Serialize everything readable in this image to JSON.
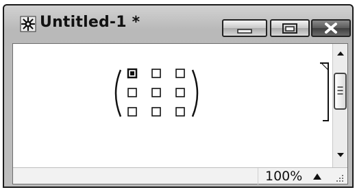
{
  "window": {
    "title": "Untitled-1 *",
    "icon": "app-gear-icon",
    "controls": [
      "minimize-icon",
      "maximize-icon",
      "close-icon"
    ]
  },
  "document": {
    "matrix": {
      "rows": 3,
      "cols": 3,
      "selected": [
        0,
        0
      ]
    },
    "placeholder_icon": "empty-placeholder-box"
  },
  "statusbar": {
    "zoom": "100%",
    "zoom_icon": "triangle-up-icon"
  },
  "colors": {
    "titlebar": "#c4c4c4",
    "text": "#111111",
    "close_button": "#5a5a5a"
  }
}
